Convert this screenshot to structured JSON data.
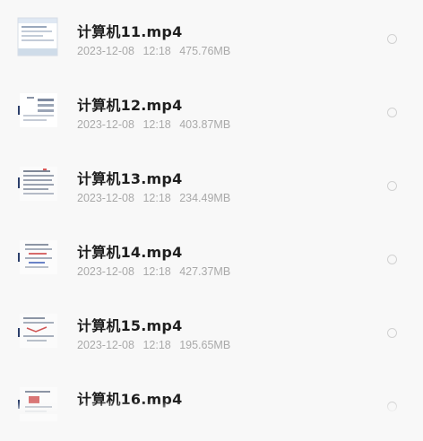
{
  "files": [
    {
      "name": "计算机11.mp4",
      "date": "2023-12-08",
      "time": "12:18",
      "size": "475.76MB",
      "thumb_icon": "video-thumbnail-icon"
    },
    {
      "name": "计算机12.mp4",
      "date": "2023-12-08",
      "time": "12:18",
      "size": "403.87MB",
      "thumb_icon": "video-thumbnail-icon"
    },
    {
      "name": "计算机13.mp4",
      "date": "2023-12-08",
      "time": "12:18",
      "size": "234.49MB",
      "thumb_icon": "video-thumbnail-icon"
    },
    {
      "name": "计算机14.mp4",
      "date": "2023-12-08",
      "time": "12:18",
      "size": "427.37MB",
      "thumb_icon": "video-thumbnail-icon"
    },
    {
      "name": "计算机15.mp4",
      "date": "2023-12-08",
      "time": "12:18",
      "size": "195.65MB",
      "thumb_icon": "video-thumbnail-icon"
    },
    {
      "name": "计算机16.mp4",
      "date": "",
      "time": "",
      "size": "",
      "thumb_icon": "video-thumbnail-icon"
    }
  ],
  "colors": {
    "background": "#f8f8f8",
    "title": "#1f1f1f",
    "meta": "#a9a9a9",
    "radio_border": "#d2d2d2"
  }
}
